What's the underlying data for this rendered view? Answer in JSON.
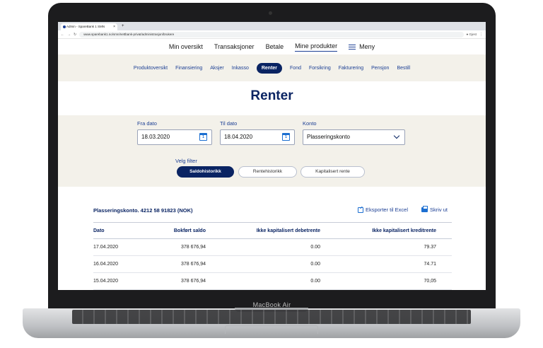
{
  "browser": {
    "tab_title": "Admin - SpareBank 1 SMN",
    "new_tab": "+",
    "url": "www.sparebank1.no/smn/nettbank-privat/administrasjon/brukere",
    "user": "Gjest",
    "close": "×"
  },
  "topnav": {
    "items": [
      "Min oversikt",
      "Transaksjoner",
      "Betale",
      "Mine produkter"
    ],
    "menu": "Meny"
  },
  "subnav": {
    "items": [
      "Produktoversikt",
      "Finansiering",
      "Aksjer",
      "Inkasso",
      "Renter",
      "Fond",
      "Forsikring",
      "Fakturering",
      "Pensjon",
      "Bestill"
    ],
    "selected": "Renter"
  },
  "page": {
    "title": "Renter"
  },
  "filter": {
    "from_label": "Fra dato",
    "from_value": "18.03.2020",
    "to_label": "Til dato",
    "to_value": "18.04.2020",
    "account_label": "Konto",
    "account_value": "Plasseringskonto",
    "calendar_glyph": "1",
    "filter_label": "Velg filter",
    "options": [
      "Saldohistorikk",
      "Rentehistorikk",
      "Kapitalisert rente"
    ],
    "selected_option": "Saldohistorikk"
  },
  "table": {
    "account_title": "Plasseringskonto. 4212 58 91823 (NOK)",
    "export_label": "Eksporter til Excel",
    "print_label": "Skriv ut",
    "headers": [
      "Dato",
      "Bokført saldo",
      "Ikke kapitalisert debetrente",
      "Ikke kapitalisert kreditrente"
    ],
    "rows": [
      [
        "17.04.2020",
        "378 676,94",
        "0.00",
        "79.37"
      ],
      [
        "16.04.2020",
        "378 676,94",
        "0.00",
        "74.71"
      ],
      [
        "15.04.2020",
        "378 676,94",
        "0.00",
        "70,05"
      ]
    ]
  },
  "laptop": {
    "brand": "MacBook Air"
  },
  "colors": {
    "brand_navy": "#0a2463",
    "accent_blue": "#1c6fd1",
    "beige_band": "#f3f1ea"
  }
}
